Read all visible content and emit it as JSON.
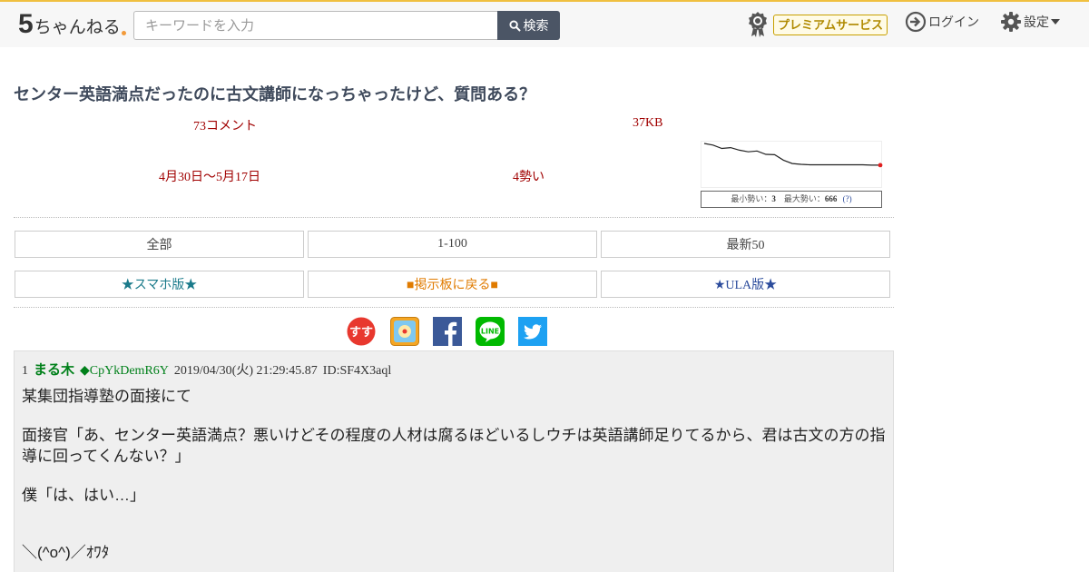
{
  "header": {
    "logo_five": "5",
    "logo_name": "ちゃんねる",
    "search_placeholder": "キーワードを入力",
    "search_button": "検索",
    "premium_label": "プレミアムサービス",
    "login_label": "ログイン",
    "settings_label": "設定"
  },
  "thread": {
    "title": "センター英語満点だったのに古文講師になっちゃったけど、質問ある？",
    "comments": "73コメント",
    "size": "37KB",
    "dates": "4月30日〜5月17日",
    "speed": "4勢い",
    "graph": {
      "legend_min_label": "最小勢い：",
      "legend_min_value": "3",
      "legend_max_label": "最大勢い：",
      "legend_max_value": "666",
      "legend_help": "(?)",
      "line_color": "#222222",
      "end_marker_color": "#e02020",
      "trend": [
        100,
        96,
        88,
        90,
        84,
        80,
        82,
        74,
        73,
        60,
        52,
        50,
        49,
        49,
        49,
        49,
        49,
        49,
        49,
        48,
        48
      ]
    }
  },
  "nav": {
    "all": "全部",
    "range": "1-100",
    "latest": "最新50",
    "smartphone": "★スマホ版★",
    "back_to_board": "■掲示板に戻る■",
    "ula": "★ULA版★"
  },
  "social": {
    "sumaho_label": "すす",
    "icons": [
      "sumaho-matome-icon",
      "bookmark-app-icon",
      "facebook-icon",
      "line-icon",
      "twitter-icon"
    ],
    "line_label": "LINE"
  },
  "post": {
    "number": "1",
    "name": "まる木",
    "trip": "◆CpYkDemR6Y",
    "datetime": "2019/04/30(火) 21:29:45.87",
    "id": "ID:SF4X3aql",
    "line1": "某集団指導塾の面接にて",
    "line2": "面接官「あ、センター英語満点？悪いけどその程度の人材は腐るほどいるしウチは英語講師足りてるから、君は古文の方の指導に回ってくんない？」",
    "line3": "僕「は、はい…」",
    "line4": "＼(^o^)／ｵﾜﾀ"
  }
}
